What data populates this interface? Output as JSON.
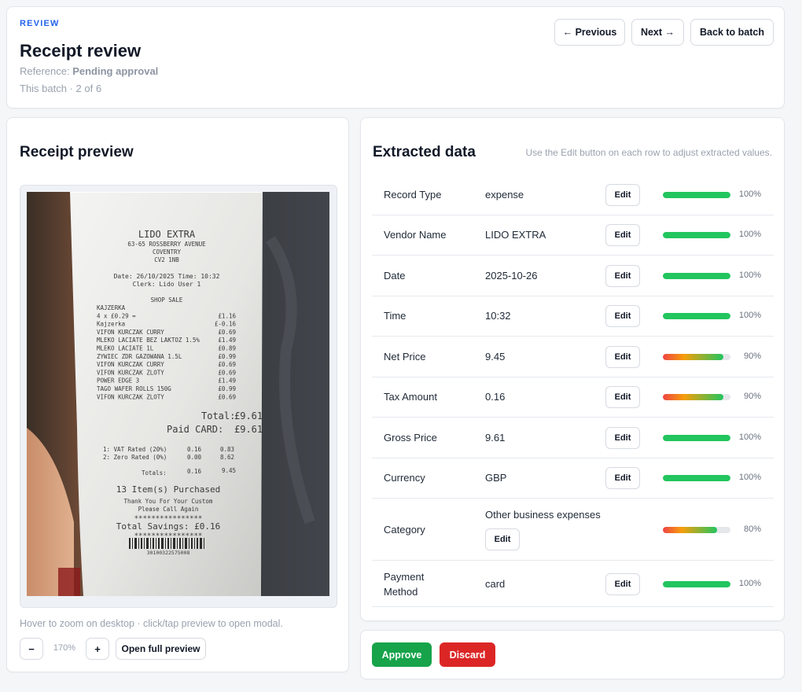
{
  "header": {
    "eyebrow": "REVIEW",
    "title": "Receipt review",
    "reference_label": "Reference:",
    "reference_value": "Pending approval",
    "batch_text": "This batch · 2 of 6",
    "previous_label": "← Previous",
    "next_label": "Next →",
    "back_label": "Back to batch"
  },
  "preview": {
    "title": "Receipt preview",
    "hint": "Hover to zoom on desktop · click/tap preview to open modal.",
    "zoom_out_label": "−",
    "zoom_level": "170%",
    "zoom_in_label": "+",
    "open_full_label": "Open full preview",
    "receipt": {
      "store": "LIDO EXTRA",
      "address1": "63-65 ROSSBERRY AVENUE",
      "address2": "COVENTRY",
      "postcode": "CV2 1NB",
      "date_line": "Date: 26/10/2025 Time: 10:32",
      "clerk_line": "Clerk: Lido User 1",
      "sale_line": "SHOP SALE",
      "items": [
        {
          "name": "KAJZERKA",
          "price": ""
        },
        {
          "name": "4 x £0.29 =",
          "price": "£1.16"
        },
        {
          "name": "Kajzerka",
          "price": "£-0.16"
        },
        {
          "name": "VIFON KURCZAK CURRY",
          "price": "£0.69"
        },
        {
          "name": "MLEKO LACIATE BEZ LAKTOZ 1.5%",
          "price": "£1.49"
        },
        {
          "name": "MLEKO LACIATE 1L",
          "price": "£0.89"
        },
        {
          "name": "ZYWIEC ZDR GAZOWANA 1.5L",
          "price": "£0.99"
        },
        {
          "name": "VIFON KURCZAK CURRY",
          "price": "£0.69"
        },
        {
          "name": "VIFON KURCZAK ZLOTY",
          "price": "£0.69"
        },
        {
          "name": "POWER EDGE 3",
          "price": "£1.49"
        },
        {
          "name": "TAGO WAFER ROLLS 150G",
          "price": "£0.99"
        },
        {
          "name": "VIFON KURCZAK ZLOTY",
          "price": "£0.69"
        }
      ],
      "total_label": "Total:",
      "total_value": "£9.61",
      "paid_label": "Paid CARD:",
      "paid_value": "£9.61",
      "vat1": "1: VAT Rated (20%)",
      "vat1_tax": "0.16",
      "vat1_net": "0.83",
      "vat2": "2: Zero Rated (0%)",
      "vat2_tax": "0.00",
      "vat2_net": "8.62",
      "totals_label": "Totals:",
      "totals_tax": "0.16",
      "totals_net": "9.45",
      "items_purchased": "13 Item(s) Purchased",
      "thanks1": "Thank You For Your Custom",
      "thanks2": "Please Call Again",
      "stars": "****************",
      "savings": "Total Savings: £0.16",
      "barcode_number": "30100322575008"
    }
  },
  "extracted": {
    "title": "Extracted data",
    "hint": "Use the Edit button on each row to adjust extracted values.",
    "edit_label": "Edit",
    "rows": [
      {
        "label": "Record Type",
        "value": "expense",
        "confidence": 1.0,
        "confidence_text": "100%"
      },
      {
        "label": "Vendor Name",
        "value": "LIDO EXTRA",
        "confidence": 1.0,
        "confidence_text": "100%"
      },
      {
        "label": "Date",
        "value": "2025-10-26",
        "confidence": 1.0,
        "confidence_text": "100%"
      },
      {
        "label": "Time",
        "value": "10:32",
        "confidence": 1.0,
        "confidence_text": "100%"
      },
      {
        "label": "Net Price",
        "value": "9.45",
        "confidence": 0.9,
        "confidence_text": "90%"
      },
      {
        "label": "Tax Amount",
        "value": "0.16",
        "confidence": 0.9,
        "confidence_text": "90%"
      },
      {
        "label": "Gross Price",
        "value": "9.61",
        "confidence": 1.0,
        "confidence_text": "100%"
      },
      {
        "label": "Currency",
        "value": "GBP",
        "confidence": 1.0,
        "confidence_text": "100%"
      },
      {
        "label": "Category",
        "value": "Other business expenses",
        "confidence": 0.8,
        "confidence_text": "80%"
      },
      {
        "label": "Payment Method",
        "value": "card",
        "confidence": 1.0,
        "confidence_text": "100%"
      }
    ]
  },
  "actions": {
    "approve_label": "Approve",
    "discard_label": "Discard"
  },
  "colors": {
    "accent": "#2563eb",
    "approve": "#16a34a",
    "discard": "#dc2626",
    "confidence_full": "#22c55e"
  }
}
